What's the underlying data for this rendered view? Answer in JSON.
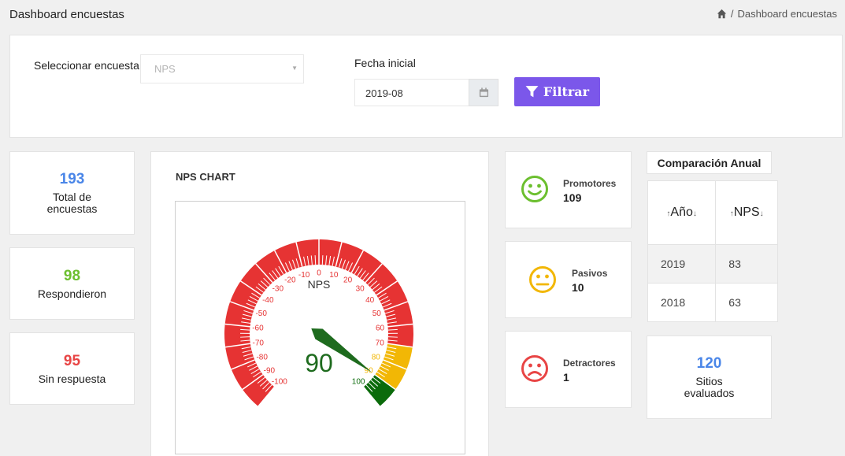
{
  "header": {
    "title": "Dashboard encuestas",
    "breadcrumb": "Dashboard encuestas"
  },
  "filters": {
    "survey_label": "Seleccionar encuesta:",
    "survey_value": "NPS",
    "date_label": "Fecha inicial",
    "date_value": "2019-08",
    "filter_button": "Filtrar"
  },
  "stats": {
    "total": {
      "value": "193",
      "label": "Total de encuestas",
      "color": "#4a86e8"
    },
    "answered": {
      "value": "98",
      "label": "Respondieron",
      "color": "#6cbf2f"
    },
    "no_answer": {
      "value": "95",
      "label": "Sin respuesta",
      "color": "#e84545"
    }
  },
  "chart_card": {
    "title": "NPS CHART"
  },
  "chart_data": {
    "type": "gauge",
    "title": "NPS",
    "value": 90,
    "min": -100,
    "max": 100,
    "ticks": [
      "-100",
      "-90",
      "-80",
      "-70",
      "-60",
      "-50",
      "-40",
      "-30",
      "-20",
      "-10",
      "0",
      "10",
      "20",
      "30",
      "40",
      "50",
      "60",
      "70",
      "80",
      "90",
      "100"
    ],
    "bands": [
      {
        "from": -100,
        "to": 70,
        "color": "#e63333"
      },
      {
        "from": 70,
        "to": 90,
        "color": "#f2b705"
      },
      {
        "from": 90,
        "to": 100,
        "color": "#0b6b0b"
      }
    ]
  },
  "categories": {
    "promotores": {
      "label": "Promotores",
      "value": "109",
      "color": "#6cbf2f"
    },
    "pasivos": {
      "label": "Pasivos",
      "value": "10",
      "color": "#f2b705"
    },
    "detractores": {
      "label": "Detractores",
      "value": "1",
      "color": "#e84545"
    }
  },
  "comparison": {
    "title": "Comparación Anual",
    "columns": [
      "Año",
      "NPS"
    ],
    "rows": [
      [
        "2019",
        "83"
      ],
      [
        "2018",
        "63"
      ]
    ]
  },
  "sites": {
    "value": "120",
    "label": "Sitios evaluados",
    "color": "#4a86e8"
  }
}
